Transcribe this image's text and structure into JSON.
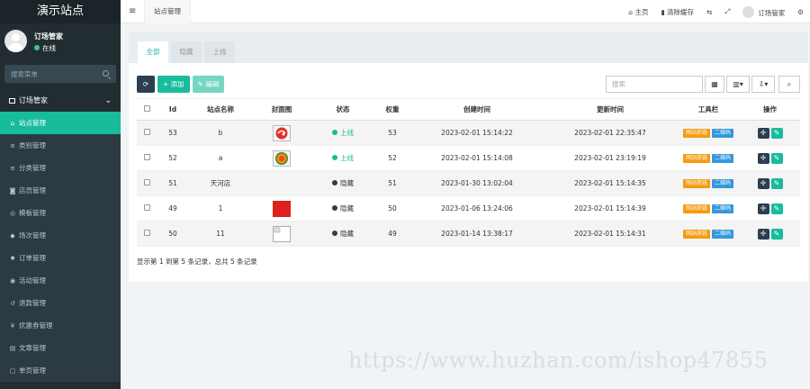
{
  "sidebar": {
    "logo": "演示站点",
    "user_name": "订场管家",
    "user_status": "在线",
    "search_placeholder": "搜索菜单",
    "group_label": "订场管家",
    "items": [
      {
        "label": "站点管理",
        "icon": "home-icon",
        "glyph": "⌂"
      },
      {
        "label": "类别管理",
        "icon": "list-icon",
        "glyph": "≡"
      },
      {
        "label": "分类管理",
        "icon": "list-icon",
        "glyph": "≡"
      },
      {
        "label": "店员管理",
        "icon": "user-icon",
        "glyph": "◙"
      },
      {
        "label": "模板管理",
        "icon": "template-icon",
        "glyph": "◎"
      },
      {
        "label": "场次管理",
        "icon": "session-icon",
        "glyph": "◆"
      },
      {
        "label": "订单管理",
        "icon": "order-icon",
        "glyph": "✹"
      },
      {
        "label": "活动管理",
        "icon": "activity-icon",
        "glyph": "◉"
      },
      {
        "label": "退款管理",
        "icon": "refund-icon",
        "glyph": "↺"
      },
      {
        "label": "优惠券管理",
        "icon": "coupon-icon",
        "glyph": "¥"
      },
      {
        "label": "文章管理",
        "icon": "article-icon",
        "glyph": "▤"
      },
      {
        "label": "单页管理",
        "icon": "page-icon",
        "glyph": "▢"
      }
    ]
  },
  "topbar": {
    "current_tab": "站点管理",
    "home": "主页",
    "clear_cache": "清除缓存",
    "user": "订场管家"
  },
  "panel": {
    "tabs": [
      "全部",
      "隐藏",
      "上线"
    ],
    "add_label": "添加",
    "edit_label": "编辑",
    "search_placeholder": "搜索",
    "columns": [
      "Id",
      "站点名称",
      "封面图",
      "状态",
      "权重",
      "创建时间",
      "更新时间",
      "工具栏",
      "操作"
    ],
    "tool_labels": [
      "网站获链",
      "二维码"
    ],
    "rows": [
      {
        "id": "53",
        "name": "b",
        "cover": "red-logo",
        "status": "上线",
        "status_key": "on",
        "weight": "53",
        "created": "2023-02-01 15:14:22",
        "updated": "2023-02-01 22:35:47"
      },
      {
        "id": "52",
        "name": "a",
        "cover": "orange-logo",
        "status": "上线",
        "status_key": "on",
        "weight": "52",
        "created": "2023-02-01 15:14:08",
        "updated": "2023-02-01 23:19:19"
      },
      {
        "id": "51",
        "name": "天河店",
        "cover": "none",
        "status": "隐藏",
        "status_key": "off",
        "weight": "51",
        "created": "2023-01-30 13:02:04",
        "updated": "2023-02-01 15:14:35"
      },
      {
        "id": "49",
        "name": "1",
        "cover": "red-square",
        "status": "隐藏",
        "status_key": "off",
        "weight": "50",
        "created": "2023-01-06 13:24:06",
        "updated": "2023-02-01 15:14:39"
      },
      {
        "id": "50",
        "name": "11",
        "cover": "broken-image",
        "status": "隐藏",
        "status_key": "off",
        "weight": "49",
        "created": "2023-01-14 13:38:17",
        "updated": "2023-02-01 15:14:31"
      }
    ],
    "summary": "显示第 1 到第 5 条记录，总共 5 条记录"
  },
  "watermark": "https://www.huzhan.com/ishop47855",
  "colors": {
    "accent": "#18bc9c",
    "sidebar_bg": "#222d32",
    "dark_button": "#2c3e50",
    "orange": "#f39c12",
    "blue": "#3498db"
  }
}
